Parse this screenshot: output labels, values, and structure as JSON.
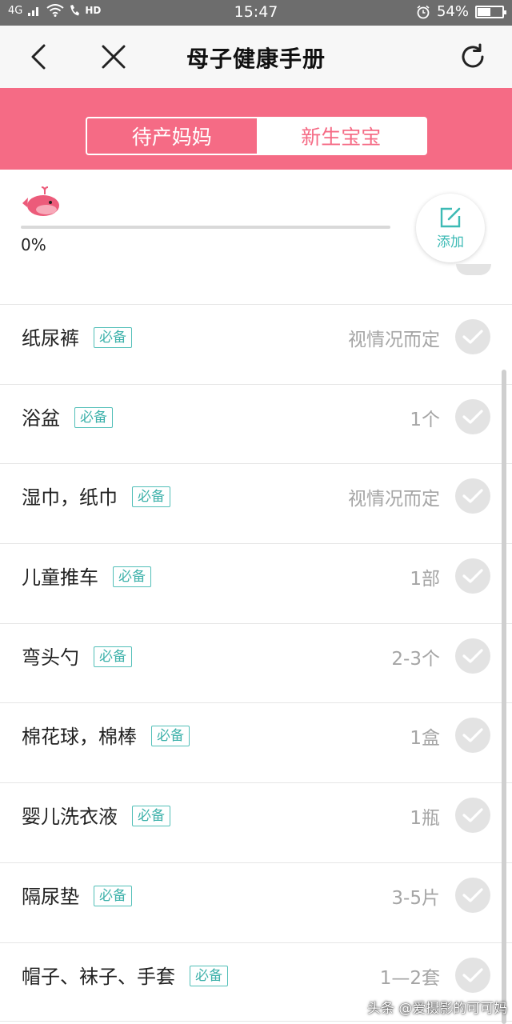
{
  "status_bar": {
    "network": "4G",
    "hd": "HD",
    "time": "15:47",
    "battery": "54%",
    "battery_level": 0.54
  },
  "header": {
    "title": "母子健康手册"
  },
  "tabs": [
    {
      "label": "待产妈妈",
      "active": true
    },
    {
      "label": "新生宝宝",
      "active": false
    }
  ],
  "progress": {
    "value": 0,
    "label": "0%"
  },
  "add_button": {
    "label": "添加"
  },
  "items": [
    {
      "name": "纸尿裤",
      "badge": "必备",
      "qty": "视情况而定"
    },
    {
      "name": "浴盆",
      "badge": "必备",
      "qty": "1个"
    },
    {
      "name": "湿巾，纸巾",
      "badge": "必备",
      "qty": "视情况而定"
    },
    {
      "name": "儿童推车",
      "badge": "必备",
      "qty": "1部"
    },
    {
      "name": "弯头勺",
      "badge": "必备",
      "qty": "2-3个"
    },
    {
      "name": "棉花球，棉棒",
      "badge": "必备",
      "qty": "1盒"
    },
    {
      "name": "婴儿洗衣液",
      "badge": "必备",
      "qty": "1瓶"
    },
    {
      "name": "隔尿垫",
      "badge": "必备",
      "qty": "3-5片"
    },
    {
      "name": "帽子、袜子、手套",
      "badge": "必备",
      "qty": "1—2套"
    }
  ],
  "watermark": "头条 @爱摄影的可可妈",
  "colors": {
    "accent": "#f56b85",
    "teal": "#3db1aa",
    "status_bar": "#6d6d6d"
  },
  "icons": {
    "back": "back-arrow-icon",
    "close": "close-icon",
    "refresh": "refresh-icon",
    "edit": "edit-icon",
    "check": "check-icon",
    "mascot": "whale-icon"
  }
}
